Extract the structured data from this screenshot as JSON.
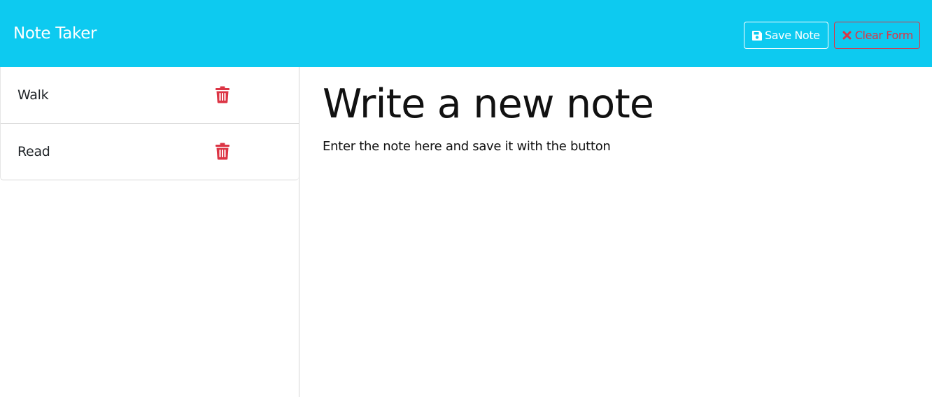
{
  "app": {
    "title": "Note Taker"
  },
  "toolbar": {
    "save_label": "Save Note",
    "save_icon": "floppy-disk-icon",
    "clear_label": "Clear Form",
    "clear_icon": "x-icon"
  },
  "notes": [
    {
      "title": "Walk",
      "delete_icon": "trash-icon"
    },
    {
      "title": "Read",
      "delete_icon": "trash-icon"
    }
  ],
  "editor": {
    "title_placeholder": "Write a new note",
    "body_placeholder": "Enter the note here and save it with the button"
  },
  "colors": {
    "navbar": "#0dcaf0",
    "danger": "#dc3545",
    "text": "#212529"
  }
}
